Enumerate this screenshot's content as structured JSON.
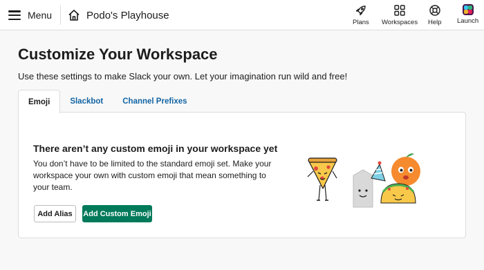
{
  "header": {
    "menu_label": "Menu",
    "workspace_name": "Podo's Playhouse",
    "nav": [
      {
        "label": "Plans",
        "icon": "rocket-icon"
      },
      {
        "label": "Workspaces",
        "icon": "grid-icon"
      },
      {
        "label": "Help",
        "icon": "lifebuoy-icon"
      },
      {
        "label": "Launch",
        "icon": "slack-logo-icon"
      }
    ]
  },
  "page": {
    "title": "Customize Your Workspace",
    "subtitle": "Use these settings to make Slack your own. Let your imagination run wild and free!",
    "tabs": [
      {
        "label": "Emoji",
        "active": true
      },
      {
        "label": "Slackbot",
        "active": false
      },
      {
        "label": "Channel Prefixes",
        "active": false
      }
    ]
  },
  "emoji_panel": {
    "title": "There aren’t any custom emoji in your workspace yet",
    "description": "You don’t have to be limited to the standard emoji set. Make your workspace your own with custom emoji that mean something to your team.",
    "add_alias_label": "Add Alias",
    "add_custom_label": "Add Custom Emoji"
  },
  "colors": {
    "accent_green": "#007a5a",
    "link_blue": "#1264a3",
    "brand_purple": "#4a154b"
  }
}
